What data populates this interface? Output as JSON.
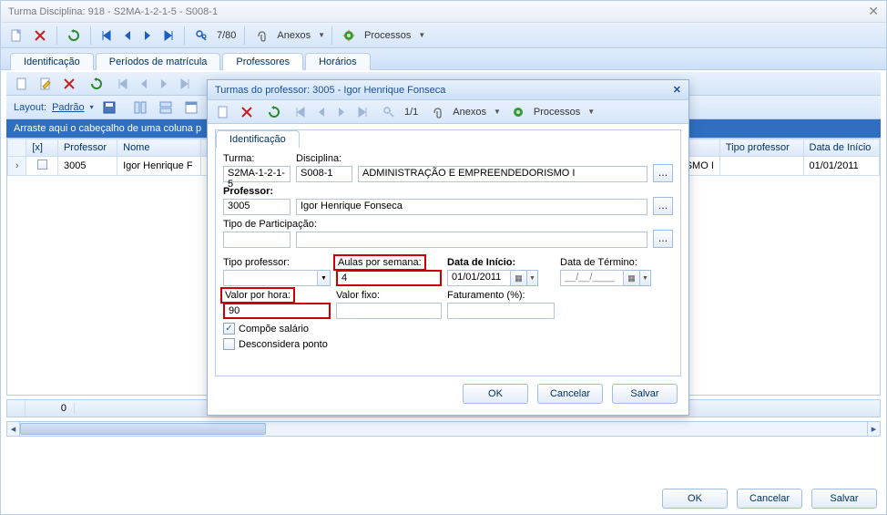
{
  "window": {
    "title": "Turma Disciplina: 918 - S2MA-1-2-1-5 - S008-1"
  },
  "toolbar": {
    "nav_counter": "7/80",
    "anexos": "Anexos",
    "processos": "Processos"
  },
  "tabs": {
    "identificacao": "Identificação",
    "periodos": "Períodos de matrícula",
    "professores": "Professores",
    "horarios": "Horários"
  },
  "layout_bar": {
    "layout_label": "Layout:",
    "layout_value": "Padrão"
  },
  "grid": {
    "group_hint_prefix": "Arraste aqui o cabeçalho de uma coluna p",
    "cols": {
      "x": "[x]",
      "professor": "Professor",
      "nome": "Nome",
      "tipo_professor": "Tipo professor",
      "data_inicio": "Data de Início"
    },
    "row": {
      "professor": "3005",
      "nome": "Igor Henrique F",
      "tipo_suffix": "SMO I",
      "data_inicio": "01/01/2011"
    },
    "footer_count": "0"
  },
  "buttons": {
    "ok": "OK",
    "cancelar": "Cancelar",
    "salvar": "Salvar"
  },
  "dialog": {
    "title": "Turmas do professor: 3005 - Igor Henrique Fonseca",
    "nav_counter": "1/1",
    "anexos": "Anexos",
    "processos": "Processos",
    "tab_ident": "Identificação",
    "labels": {
      "turma": "Turma:",
      "disciplina": "Disciplina:",
      "professor": "Professor:",
      "tipo_participacao": "Tipo de Participação:",
      "tipo_professor": "Tipo professor:",
      "aulas_semana": "Aulas por semana:",
      "data_inicio": "Data de Início:",
      "data_termino": "Data de Término:",
      "valor_hora": "Valor por hora:",
      "valor_fixo": "Valor fixo:",
      "faturamento": "Faturamento (%):",
      "compoe_salario": "Compõe salário",
      "desconsidera_ponto": "Desconsidera ponto"
    },
    "values": {
      "turma": "S2MA-1-2-1-5",
      "disciplina_cod": "S008-1",
      "disciplina_nome": "ADMINISTRAÇÃO E EMPREENDEDORISMO I",
      "professor_cod": "3005",
      "professor_nome": "Igor Henrique Fonseca",
      "tipo_participacao_cod": "",
      "tipo_participacao_nome": "",
      "tipo_professor": "",
      "aulas_semana": "4",
      "data_inicio": "01/01/2011",
      "data_termino": "__/__/____",
      "valor_hora": "90",
      "valor_fixo": "",
      "faturamento": "",
      "compoe_salario_checked": "✓",
      "desconsidera_ponto_checked": ""
    }
  }
}
